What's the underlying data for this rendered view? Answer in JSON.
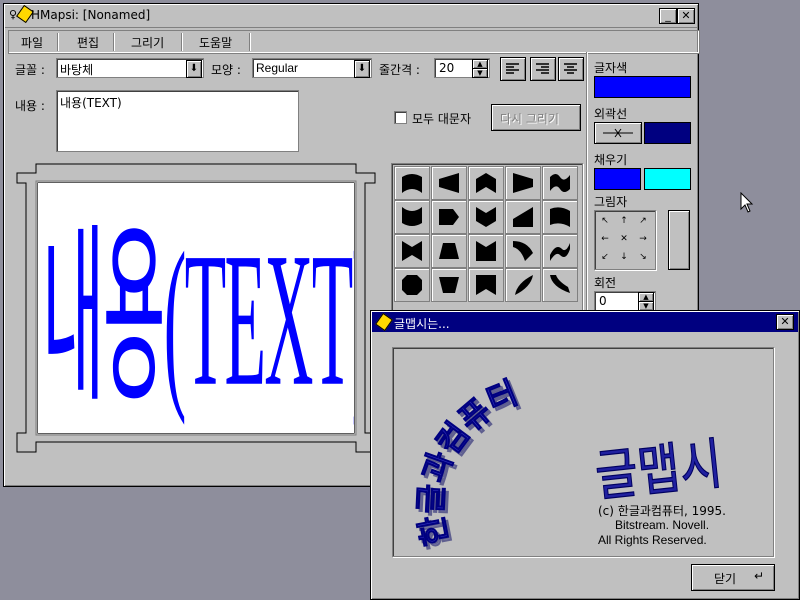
{
  "main_window": {
    "title": "HMapsi: [Nonamed]",
    "minimize_glyph": "_",
    "close_glyph": "✕",
    "menu": [
      {
        "label": "파일"
      },
      {
        "label": "편집"
      },
      {
        "label": "그리기"
      },
      {
        "label": "도움말"
      }
    ]
  },
  "toolbar": {
    "font_label": "글꼴 :",
    "font_value": "바탕체",
    "style_label": "모양 :",
    "style_value": "Regular",
    "spacing_label": "줄간격 :",
    "spacing_value": "20"
  },
  "content": {
    "label": "내용 :",
    "value": "내용(TEXT)",
    "uppercase_checkbox_label": "모두 대문자",
    "uppercase_checked": false,
    "redraw_button": "다시 그리기"
  },
  "preview": {
    "text": "내용(TEXT)",
    "color": "#0000ff"
  },
  "right_panel": {
    "text_color_label": "글자색",
    "text_color": "#0000ff",
    "outline_label": "외곽선",
    "outline_color": "#000080",
    "fill_label": "채우기",
    "fill_color_1": "#0000ff",
    "fill_color_2": "#00ffff",
    "shadow_label": "그림자",
    "shadow_arrows": [
      "↖",
      "↑",
      "↗",
      "←",
      "✕",
      "→",
      "↙",
      "↓",
      "↘"
    ],
    "rotation_label": "회전",
    "rotation_value": "0"
  },
  "about_dialog": {
    "title": "글맵시는...",
    "close_glyph": "✕",
    "logo_arc_text": "한글과컴퓨터",
    "logo_main_text": "글맵시",
    "copyright_line1": "(c) 한글과컴퓨터, 1995.",
    "copyright_line2": "Bitstream. Novell.",
    "copyright_line3": "All Rights Reserved.",
    "close_button": "닫기"
  }
}
